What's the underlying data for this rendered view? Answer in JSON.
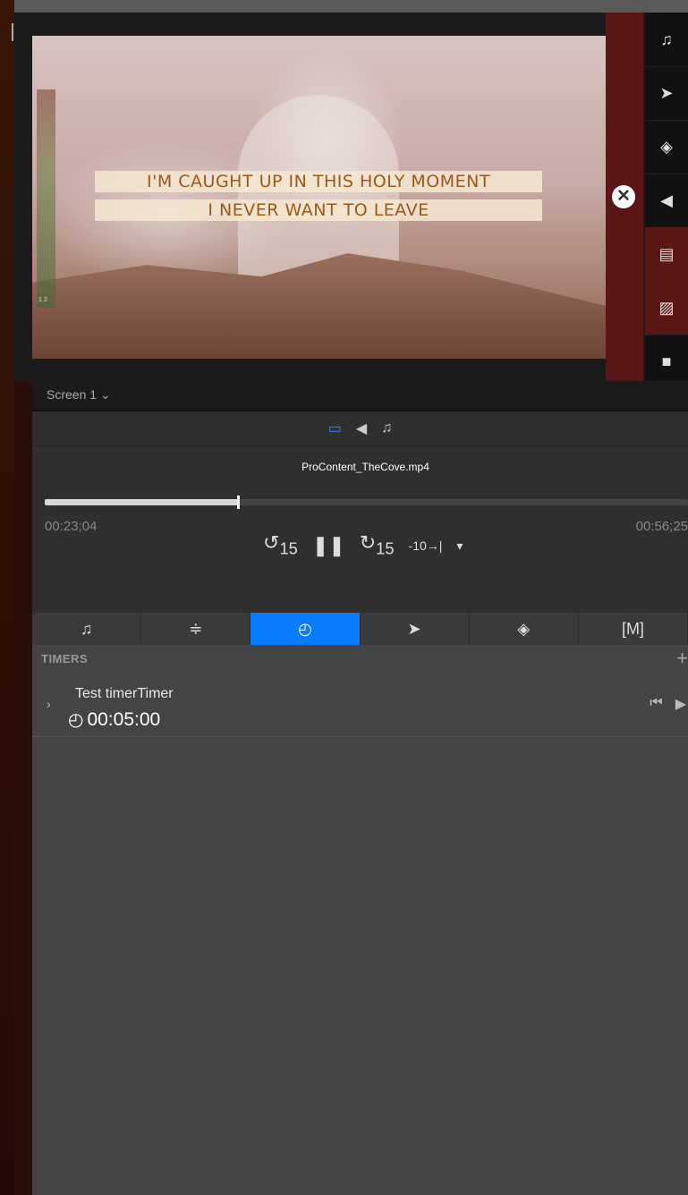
{
  "preview": {
    "lyrics": [
      "I'M CAUGHT UP IN THIS HOLY MOMENT",
      "I NEVER WANT TO LEAVE"
    ],
    "meter_label": "1  2",
    "close_symbol": "✕",
    "side_icons": [
      {
        "icon": "music-note-icon",
        "glyph": "♫"
      },
      {
        "icon": "send-icon",
        "glyph": "➤"
      },
      {
        "icon": "layers-icon",
        "glyph": "◈"
      },
      {
        "icon": "announcement-icon",
        "glyph": "◀"
      },
      {
        "icon": "slides-icon",
        "glyph": "▤"
      },
      {
        "icon": "image-icon",
        "glyph": "▨"
      },
      {
        "icon": "video-camera-icon",
        "glyph": "■"
      }
    ]
  },
  "screen": {
    "label": "Screen 1 ⌄"
  },
  "transport": {
    "mode_icons": [
      {
        "icon": "screen-icon",
        "glyph": "▭"
      },
      {
        "icon": "announcement-icon",
        "glyph": "◀"
      },
      {
        "icon": "music-note-icon",
        "glyph": "♫"
      }
    ],
    "filename": "ProContent_TheCove.mp4",
    "progress": 0.3,
    "time_elapsed": "00:23;04",
    "time_total": "00:56;25",
    "skip_back_label": "15",
    "skip_forward_label": "15",
    "go_back_label": "-10"
  },
  "tabs": [
    {
      "icon": "music-note-icon",
      "glyph": "♫"
    },
    {
      "icon": "stage-icon",
      "glyph": "≑"
    },
    {
      "icon": "timer-icon",
      "glyph": "◴"
    },
    {
      "icon": "send-icon",
      "glyph": "➤"
    },
    {
      "icon": "layers-icon",
      "glyph": "◈"
    },
    {
      "icon": "macro-icon",
      "glyph": "[M]"
    }
  ],
  "timers": {
    "header": "TIMERS",
    "add_symbol": "+",
    "items": [
      {
        "name": "Test timerTimer",
        "value": "00:05:00"
      }
    ]
  },
  "colors": {
    "accent": "#0a7aff",
    "red_panel": "#5a1715",
    "lyric_text": "#9a5a18"
  }
}
